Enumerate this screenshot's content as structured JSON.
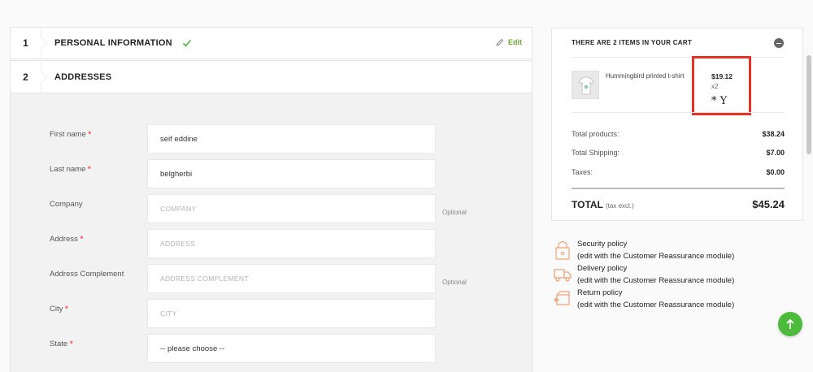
{
  "checkout": {
    "step1": {
      "number": "1",
      "title": "PERSONAL INFORMATION",
      "edit_label": "Edit"
    },
    "step2": {
      "number": "2",
      "title": "ADDRESSES"
    },
    "fields": [
      {
        "label": "First name",
        "required": "*",
        "value": "seif eddine",
        "placeholder": "",
        "optional": ""
      },
      {
        "label": "Last name",
        "required": "*",
        "value": "belgherbi",
        "placeholder": "",
        "optional": ""
      },
      {
        "label": "Company",
        "required": "",
        "value": "",
        "placeholder": "COMPANY",
        "optional": "Optional"
      },
      {
        "label": "Address",
        "required": "*",
        "value": "",
        "placeholder": "ADDRESS",
        "optional": ""
      },
      {
        "label": "Address Complement",
        "required": "",
        "value": "",
        "placeholder": "ADDRESS COMPLEMENT",
        "optional": "Optional"
      },
      {
        "label": "City",
        "required": "*",
        "value": "",
        "placeholder": "CITY",
        "optional": ""
      },
      {
        "label": "State",
        "required": "*",
        "value": "-- please choose --",
        "placeholder": "",
        "optional": ""
      }
    ]
  },
  "cart": {
    "title": "THERE ARE 2 ITEMS IN YOUR CART",
    "product": {
      "name": "Hummingbird printed t-shirt",
      "price": "$19.12",
      "quantity": "x2",
      "attribute": "* Y"
    },
    "highlight_color": "#e53222",
    "lines": [
      {
        "label": "Total products:",
        "value": "$38.24"
      },
      {
        "label": "Total Shipping:",
        "value": "$7.00"
      },
      {
        "label": "Taxes:",
        "value": "$0.00"
      }
    ],
    "total": {
      "label": "TOTAL",
      "sub": "(tax excl.)",
      "value": "$45.24"
    }
  },
  "reassurance": [
    {
      "title": "Security policy",
      "desc": "(edit with the Customer Reassurance module)",
      "icon": "lock-icon"
    },
    {
      "title": "Delivery policy",
      "desc": "(edit with the Customer Reassurance module)",
      "icon": "truck-icon"
    },
    {
      "title": "Return policy",
      "desc": "(edit with the Customer Reassurance module)",
      "icon": "return-box-icon"
    }
  ],
  "colors": {
    "accent_green": "#4cbb3c",
    "required_red": "#ff4c4c",
    "icon_orange": "#f0a070"
  }
}
